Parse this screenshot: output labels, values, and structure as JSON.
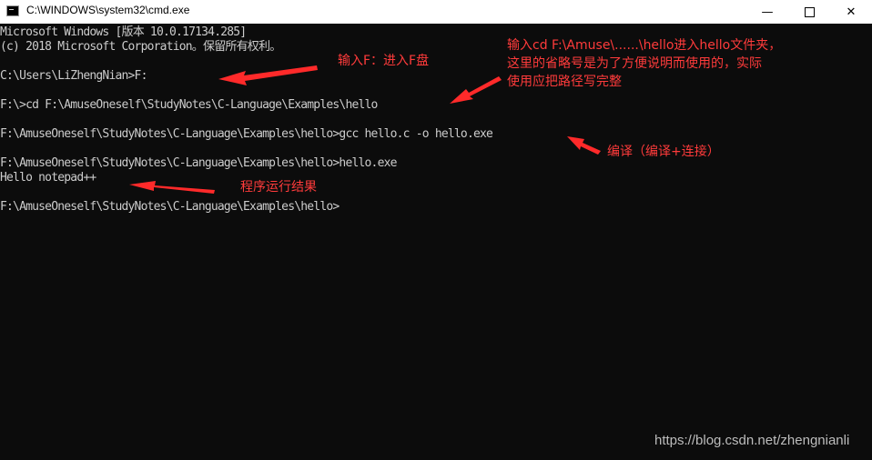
{
  "window": {
    "title": "C:\\WINDOWS\\system32\\cmd.exe",
    "icon": "cmd-icon",
    "controls": {
      "minimize": "—",
      "close": "✕"
    }
  },
  "console": {
    "lines": [
      "Microsoft Windows [版本 10.0.17134.285]",
      "(c) 2018 Microsoft Corporation。保留所有权利。",
      "C:\\Users\\LiZhengNian>F:",
      "F:\\>cd F:\\AmuseOneself\\StudyNotes\\C-Language\\Examples\\hello",
      "F:\\AmuseOneself\\StudyNotes\\C-Language\\Examples\\hello>gcc hello.c -o hello.exe",
      "F:\\AmuseOneself\\StudyNotes\\C-Language\\Examples\\hello>hello.exe",
      "Hello notepad++",
      "F:\\AmuseOneself\\StudyNotes\\C-Language\\Examples\\hello>"
    ]
  },
  "annotations": {
    "enter_f": "输入F：进入F盘",
    "cd_note": "输入cd F:\\Amuse\\......\\hello进入hello文件夹，\n这里的省略号是为了方便说明而使用的，实际\n使用应把路径写完整",
    "compile": "编译（编译+连接）",
    "result": "程序运行结果",
    "color": "#ff3b3b"
  },
  "watermark": "https://blog.csdn.net/zhengnianli"
}
